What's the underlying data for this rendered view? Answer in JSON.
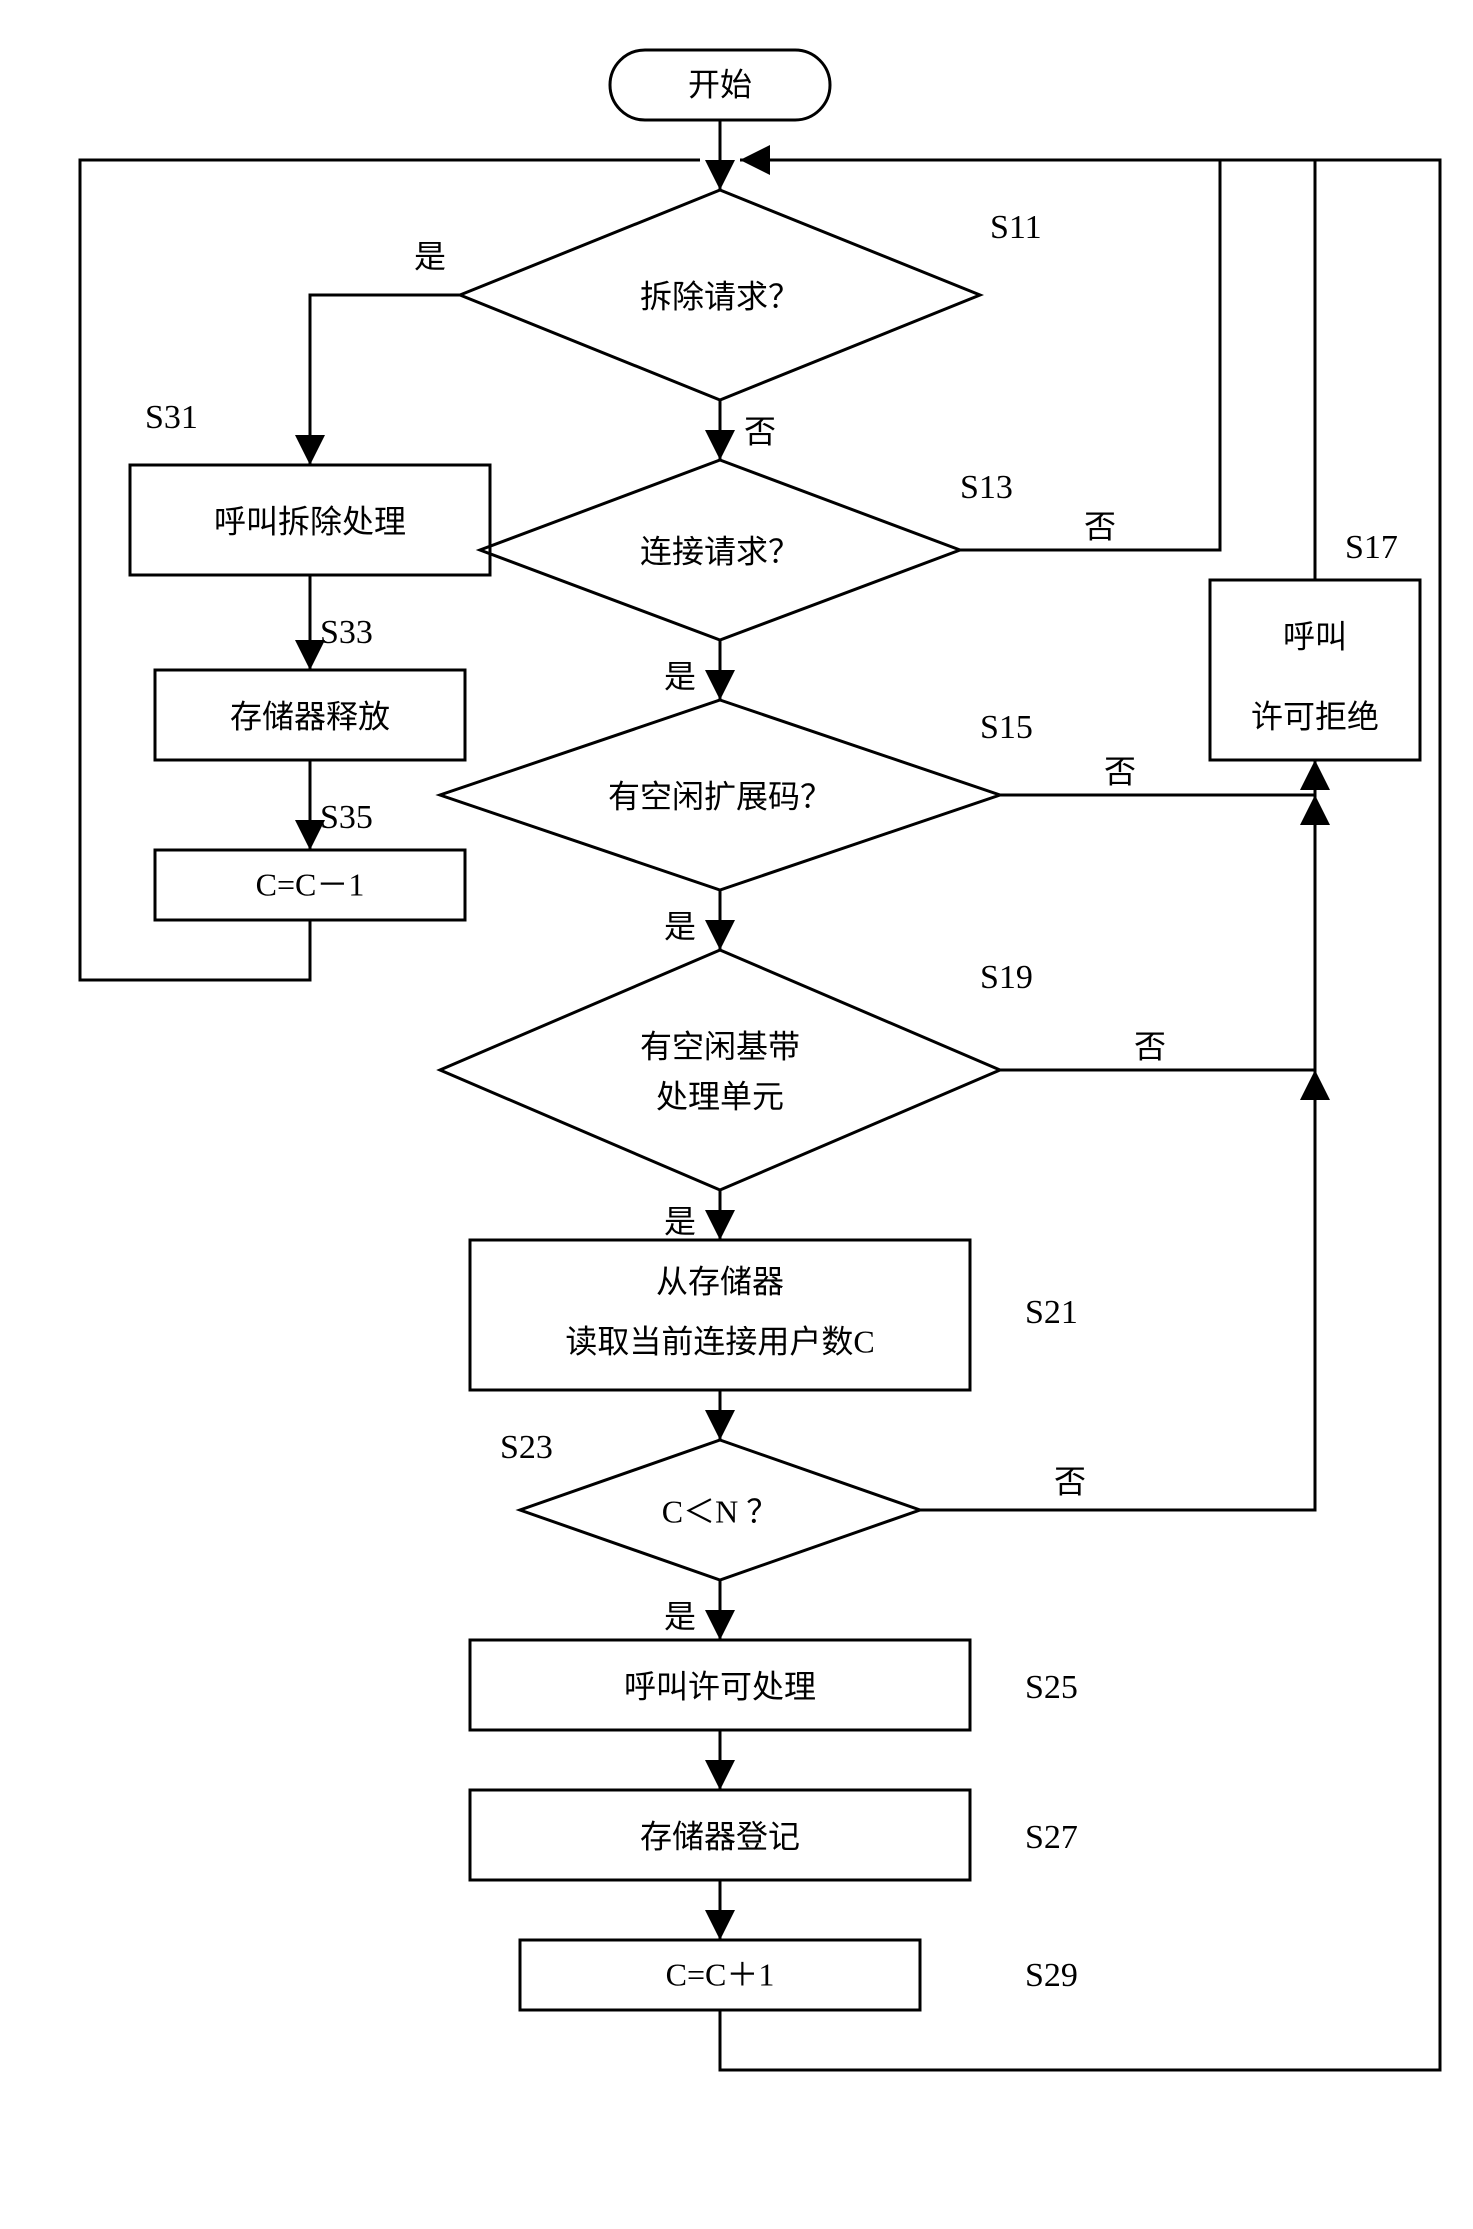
{
  "title": "开始",
  "nodes": {
    "s11": {
      "label": "S11",
      "text": "拆除请求？"
    },
    "s13": {
      "label": "S13",
      "text": "连接请求？"
    },
    "s15": {
      "label": "S15",
      "text": "有空闲扩展码？"
    },
    "s17": {
      "label": "S17",
      "line1": "呼叫",
      "line2": "许可拒绝"
    },
    "s19": {
      "label": "S19",
      "line1": "有空闲基带",
      "line2": "处理单元"
    },
    "s21": {
      "label": "S21",
      "line1": "从存储器",
      "line2": "读取当前连接用户数C"
    },
    "s23": {
      "label": "S23",
      "text": "C＜N ？"
    },
    "s25": {
      "label": "S25",
      "text": "呼叫许可处理"
    },
    "s27": {
      "label": "S27",
      "text": "存储器登记"
    },
    "s29": {
      "label": "S29",
      "text": "C=C＋1"
    },
    "s31": {
      "label": "S31",
      "text": "呼叫拆除处理"
    },
    "s33": {
      "label": "S33",
      "text": "存储器释放"
    },
    "s35": {
      "label": "S35",
      "text": "C=C－1"
    }
  },
  "edges": {
    "yes": "是",
    "no": "否"
  }
}
